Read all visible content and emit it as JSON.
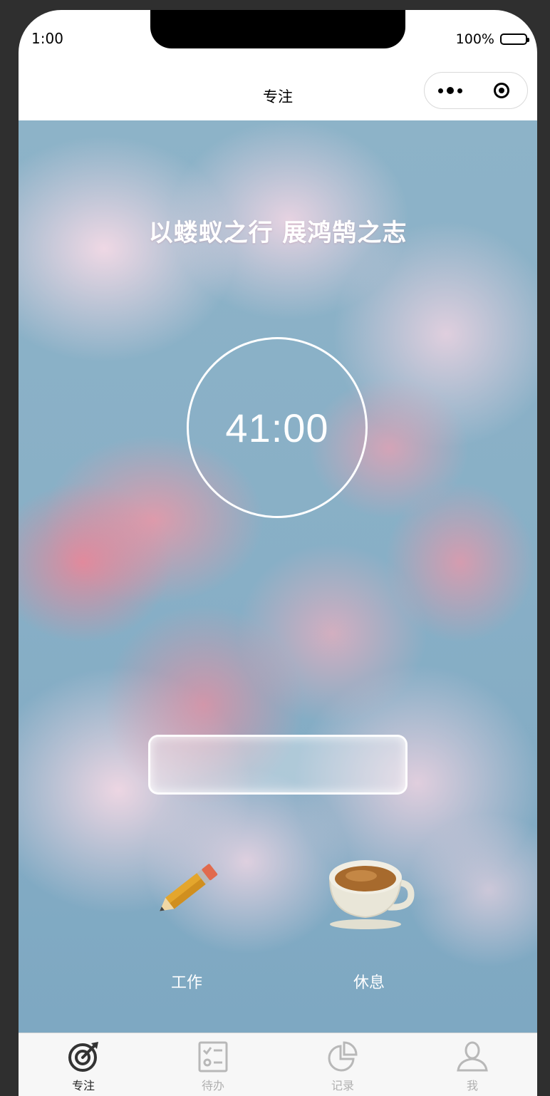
{
  "status_bar": {
    "time": "1:00",
    "battery": "100%"
  },
  "navbar": {
    "title": "专注"
  },
  "motto": "以蝼蚁之行 展鸿鹄之志",
  "timer": {
    "display": "41:00"
  },
  "task_input": {
    "value": "",
    "placeholder": ""
  },
  "modes": [
    {
      "label": "工作",
      "icon": "pencil-icon"
    },
    {
      "label": "休息",
      "icon": "coffee-cup-icon"
    }
  ],
  "tabbar": {
    "items": [
      {
        "label": "专注",
        "icon": "focus-target-icon",
        "active": true
      },
      {
        "label": "待办",
        "icon": "todo-list-icon",
        "active": false
      },
      {
        "label": "记录",
        "icon": "pie-chart-icon",
        "active": false
      },
      {
        "label": "我",
        "icon": "user-icon",
        "active": false
      }
    ]
  },
  "colors": {
    "background": "#88afc6",
    "accent": "#f08c9e",
    "inactive_tab": "#b0b0b0"
  }
}
